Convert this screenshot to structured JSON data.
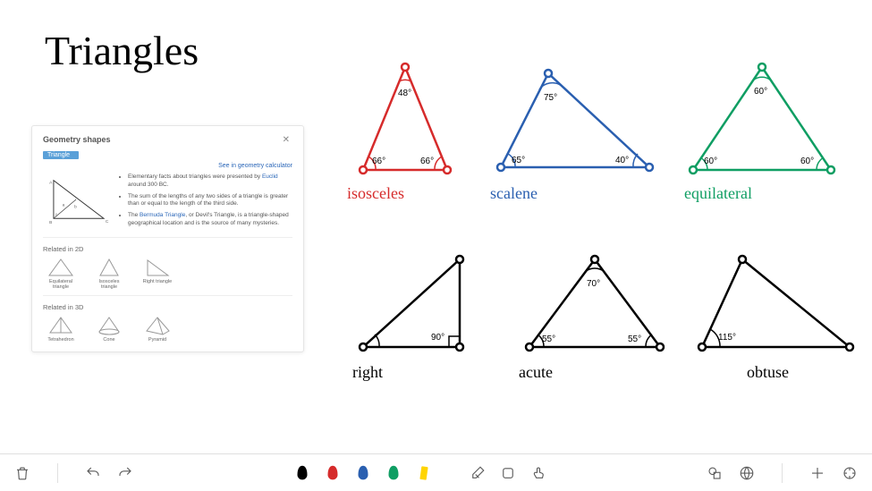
{
  "title": "Triangles",
  "info_card": {
    "title": "Geometry shapes",
    "tag": "Triangle",
    "link": "See in geometry calculator",
    "bullets": [
      "Elementary facts about triangles were presented by <b>Euclid</b> around 300 BC.",
      "The sum of the lengths of any two sides of a triangle is greater than or equal to the length of the third side.",
      "The <b>Bermuda Triangle</b>, or Devil's Triangle, is a triangle-shaped geographical location and is the source of many mysteries."
    ],
    "related2d_title": "Related in 2D",
    "related2d": [
      "Equilateral triangle",
      "Isosceles triangle",
      "Right triangle"
    ],
    "related3d_title": "Related in 3D",
    "related3d": [
      "Tetrahedron",
      "Cone",
      "Pyramid"
    ]
  },
  "triangles": {
    "isosceles": {
      "label": "isosceles",
      "color": "#d62b2b",
      "angles": {
        "top": "48°",
        "left": "66°",
        "right": "66°"
      }
    },
    "scalene": {
      "label": "scalene",
      "color": "#2a5fb0",
      "angles": {
        "top": "75°",
        "left": "65°",
        "right": "40°"
      }
    },
    "equilateral": {
      "label": "equilateral",
      "color": "#0f9e63",
      "angles": {
        "top": "60°",
        "left": "60°",
        "right": "60°"
      }
    },
    "right": {
      "label": "right",
      "color": "#000",
      "angles": {
        "right": "90°"
      }
    },
    "acute": {
      "label": "acute",
      "color": "#000",
      "angles": {
        "top": "70°",
        "left": "55°",
        "right": "55°"
      }
    },
    "obtuse": {
      "label": "obtuse",
      "color": "#000",
      "angles": {
        "left": "115°"
      }
    }
  },
  "toolbar": {
    "pen_colors": [
      "#000000",
      "#d62b2b",
      "#2a5fb0",
      "#0f9e63",
      "#ffd400"
    ]
  }
}
